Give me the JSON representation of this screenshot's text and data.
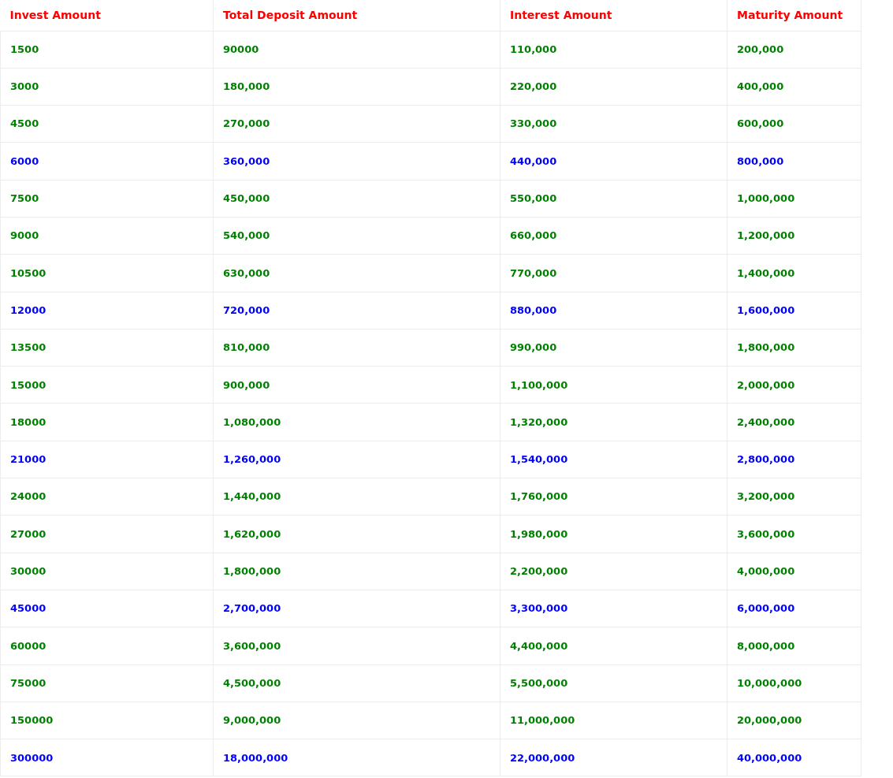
{
  "table": {
    "columns": [
      "Invest Amount",
      "Total Deposit Amount",
      "Interest Amount",
      "Maturity Amount"
    ],
    "rows": [
      {
        "color": "#008000",
        "cells": [
          "1500",
          "90000",
          "110,000",
          "200,000"
        ]
      },
      {
        "color": "#008000",
        "cells": [
          "3000",
          "180,000",
          "220,000",
          "400,000"
        ]
      },
      {
        "color": "#008000",
        "cells": [
          "4500",
          "270,000",
          "330,000",
          "600,000"
        ]
      },
      {
        "color": "#0000ff",
        "cells": [
          "6000",
          "360,000",
          "440,000",
          "800,000"
        ]
      },
      {
        "color": "#008000",
        "cells": [
          "7500",
          "450,000",
          "550,000",
          "1,000,000"
        ]
      },
      {
        "color": "#008000",
        "cells": [
          "9000",
          "540,000",
          "660,000",
          "1,200,000"
        ]
      },
      {
        "color": "#008000",
        "cells": [
          "10500",
          "630,000",
          "770,000",
          "1,400,000"
        ]
      },
      {
        "color": "#0000ff",
        "cells": [
          "12000",
          "720,000",
          "880,000",
          "1,600,000"
        ]
      },
      {
        "color": "#008000",
        "cells": [
          "13500",
          "810,000",
          "990,000",
          "1,800,000"
        ]
      },
      {
        "color": "#008000",
        "cells": [
          "15000",
          "900,000",
          "1,100,000",
          "2,000,000"
        ]
      },
      {
        "color": "#008000",
        "cells": [
          "18000",
          "1,080,000",
          "1,320,000",
          "2,400,000"
        ]
      },
      {
        "color": "#0000ff",
        "cells": [
          "21000",
          "1,260,000",
          "1,540,000",
          "2,800,000"
        ]
      },
      {
        "color": "#008000",
        "cells": [
          "24000",
          "1,440,000",
          "1,760,000",
          "3,200,000"
        ]
      },
      {
        "color": "#008000",
        "cells": [
          "27000",
          "1,620,000",
          "1,980,000",
          "3,600,000"
        ]
      },
      {
        "color": "#008000",
        "cells": [
          "30000",
          "1,800,000",
          "2,200,000",
          "4,000,000"
        ]
      },
      {
        "color": "#0000ff",
        "cells": [
          "45000",
          "2,700,000",
          "3,300,000",
          "6,000,000"
        ]
      },
      {
        "color": "#008000",
        "cells": [
          "60000",
          "3,600,000",
          "4,400,000",
          "8,000,000"
        ]
      },
      {
        "color": "#008000",
        "cells": [
          "75000",
          "4,500,000",
          "5,500,000",
          "10,000,000"
        ]
      },
      {
        "color": "#008000",
        "cells": [
          "150000",
          "9,000,000",
          "11,000,000",
          "20,000,000"
        ]
      },
      {
        "color": "#0000ff",
        "cells": [
          "300000",
          "18,000,000",
          "22,000,000",
          "40,000,000"
        ]
      }
    ]
  }
}
